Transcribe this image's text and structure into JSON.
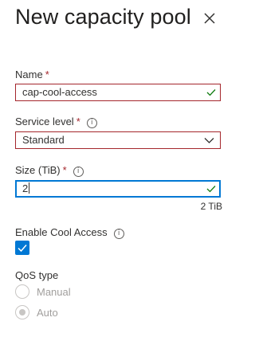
{
  "panel": {
    "title": "New capacity pool",
    "close_icon": "close-icon"
  },
  "name": {
    "label": "Name",
    "required_mark": "*",
    "value": "cap-cool-access",
    "valid": true
  },
  "service_level": {
    "label": "Service level",
    "required_mark": "*",
    "selected": "Standard"
  },
  "size": {
    "label": "Size (TiB)",
    "required_mark": "*",
    "value": "2",
    "hint": "2 TiB",
    "valid": true
  },
  "cool_access": {
    "label": "Enable Cool Access",
    "checked": true
  },
  "qos": {
    "label": "QoS type",
    "options": [
      {
        "label": "Manual",
        "selected": false,
        "disabled": true
      },
      {
        "label": "Auto",
        "selected": true,
        "disabled": true
      }
    ]
  },
  "colors": {
    "accent": "#0078d4",
    "required": "#a4262c",
    "valid_check": "#107c10",
    "disabled_text": "#a19f9d"
  }
}
